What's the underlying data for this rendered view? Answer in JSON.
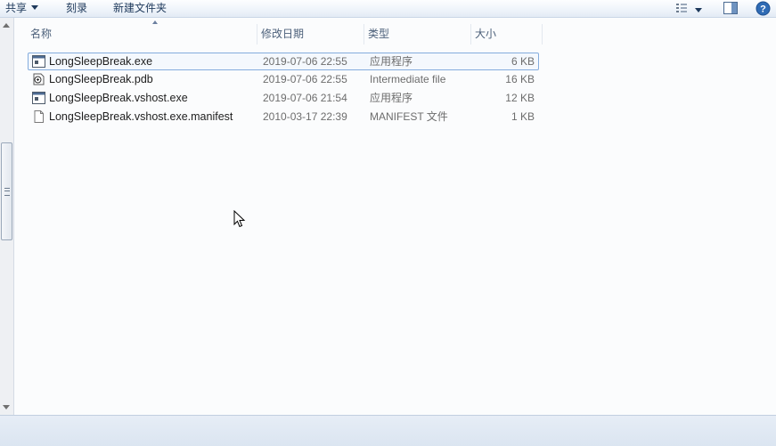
{
  "toolbar": {
    "share_label": "共享",
    "burn_label": "刻录",
    "new_folder_label": "新建文件夹"
  },
  "icons": {
    "view": "view-details-icon",
    "preview_pane": "preview-pane-icon",
    "help": "help-icon"
  },
  "columns": {
    "name": "名称",
    "date": "修改日期",
    "type": "类型",
    "size": "大小"
  },
  "files": [
    {
      "name": "LongSleepBreak.exe",
      "date": "2019-07-06 22:55",
      "type": "应用程序",
      "size": "6 KB",
      "icon": "exe-icon"
    },
    {
      "name": "LongSleepBreak.pdb",
      "date": "2019-07-06 22:55",
      "type": "Intermediate file",
      "size": "16 KB",
      "icon": "pdb-icon"
    },
    {
      "name": "LongSleepBreak.vshost.exe",
      "date": "2019-07-06 21:54",
      "type": "应用程序",
      "size": "12 KB",
      "icon": "exe-icon"
    },
    {
      "name": "LongSleepBreak.vshost.exe.manifest",
      "date": "2010-03-17 22:39",
      "type": "MANIFEST 文件",
      "size": "1 KB",
      "icon": "file-icon"
    }
  ],
  "colors": {
    "selection_border": "#84acdd",
    "header_text": "#4c607a",
    "toolbar_text": "#1e395b"
  }
}
